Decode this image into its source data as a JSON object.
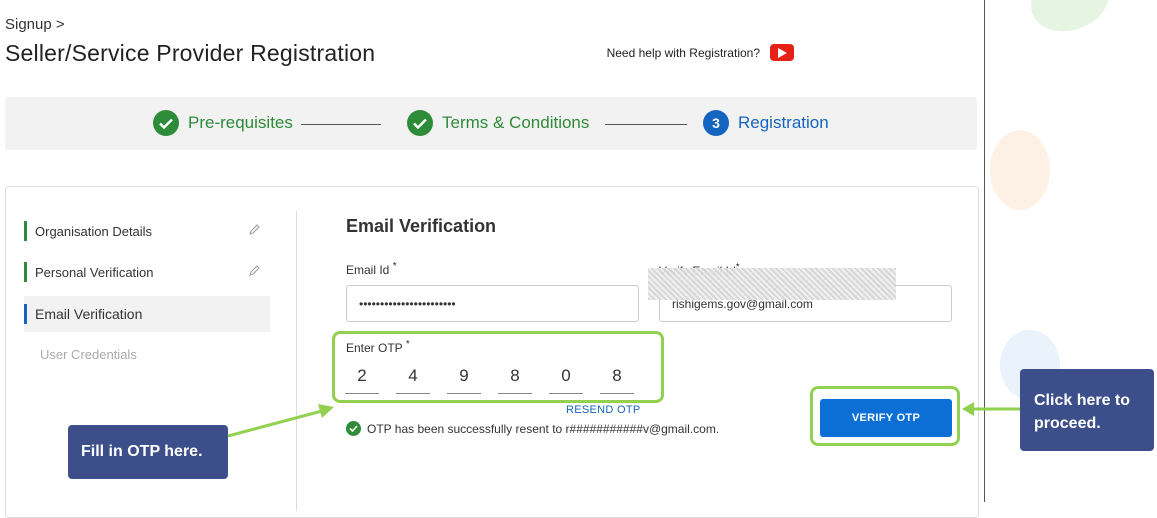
{
  "breadcrumb": "Signup >",
  "page_title": "Seller/Service Provider Registration",
  "help": {
    "text": "Need help with Registration?",
    "icon": "youtube-icon"
  },
  "steps": [
    {
      "label": "Pre-requisites",
      "state": "done",
      "icon": "check-icon"
    },
    {
      "label": "Terms & Conditions",
      "state": "done",
      "icon": "check-icon"
    },
    {
      "number": "3",
      "label": "Registration",
      "state": "active"
    }
  ],
  "sidebar": {
    "items": [
      {
        "label": "Organisation Details",
        "state": "done",
        "icon": "pencil-icon"
      },
      {
        "label": "Personal Verification",
        "state": "done",
        "icon": "pencil-icon"
      },
      {
        "label": "Email Verification",
        "state": "active"
      },
      {
        "label": "User Credentials",
        "state": "disabled"
      }
    ]
  },
  "form": {
    "title": "Email Verification",
    "email_label": "Email Id",
    "email_value": "•••••••••••••••••••••••",
    "verify_email_label": "Verify Email Id",
    "verify_email_value": "rishigems.gov@gmail.com",
    "otp_label": "Enter OTP",
    "required_mark": "*",
    "otp_digits": [
      "2",
      "4",
      "9",
      "8",
      "0",
      "8"
    ],
    "resend_label": "RESEND OTP",
    "status_text": "OTP has been successfully resent to r###########v@gmail.com.",
    "verify_button": "VERIFY OTP"
  },
  "callouts": {
    "fill_otp": "Fill in OTP here.",
    "proceed": "Click here to proceed."
  },
  "colors": {
    "success_green": "#2e8b3a",
    "primary_blue": "#0b6fd6",
    "active_blue": "#1565c0",
    "highlight_green": "#92d050",
    "callout_bg": "#3c4f8a"
  }
}
